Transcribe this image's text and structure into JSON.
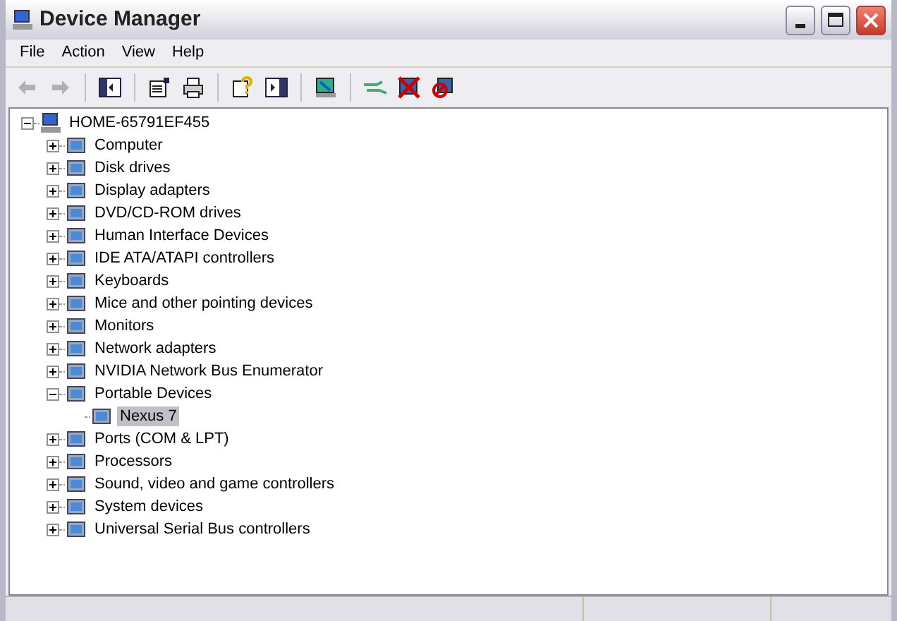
{
  "window": {
    "title": "Device Manager"
  },
  "menu": [
    "File",
    "Action",
    "View",
    "Help"
  ],
  "tree": {
    "label": "HOME-65791EF455",
    "expanded": true,
    "selected": false,
    "children": [
      {
        "label": "Computer",
        "expanded": false,
        "selected": false
      },
      {
        "label": "Disk drives",
        "expanded": false,
        "selected": false
      },
      {
        "label": "Display adapters",
        "expanded": false,
        "selected": false
      },
      {
        "label": "DVD/CD-ROM drives",
        "expanded": false,
        "selected": false
      },
      {
        "label": "Human Interface Devices",
        "expanded": false,
        "selected": false
      },
      {
        "label": "IDE ATA/ATAPI controllers",
        "expanded": false,
        "selected": false
      },
      {
        "label": "Keyboards",
        "expanded": false,
        "selected": false
      },
      {
        "label": "Mice and other pointing devices",
        "expanded": false,
        "selected": false
      },
      {
        "label": "Monitors",
        "expanded": false,
        "selected": false
      },
      {
        "label": "Network adapters",
        "expanded": false,
        "selected": false
      },
      {
        "label": "NVIDIA Network Bus Enumerator",
        "expanded": false,
        "selected": false
      },
      {
        "label": "Portable Devices",
        "expanded": true,
        "selected": false,
        "children": [
          {
            "label": "Nexus 7",
            "selected": true
          }
        ]
      },
      {
        "label": "Ports (COM & LPT)",
        "expanded": false,
        "selected": false
      },
      {
        "label": "Processors",
        "expanded": false,
        "selected": false
      },
      {
        "label": "Sound, video and game controllers",
        "expanded": false,
        "selected": false
      },
      {
        "label": "System devices",
        "expanded": false,
        "selected": false
      },
      {
        "label": "Universal Serial Bus controllers",
        "expanded": false,
        "selected": false
      }
    ]
  }
}
